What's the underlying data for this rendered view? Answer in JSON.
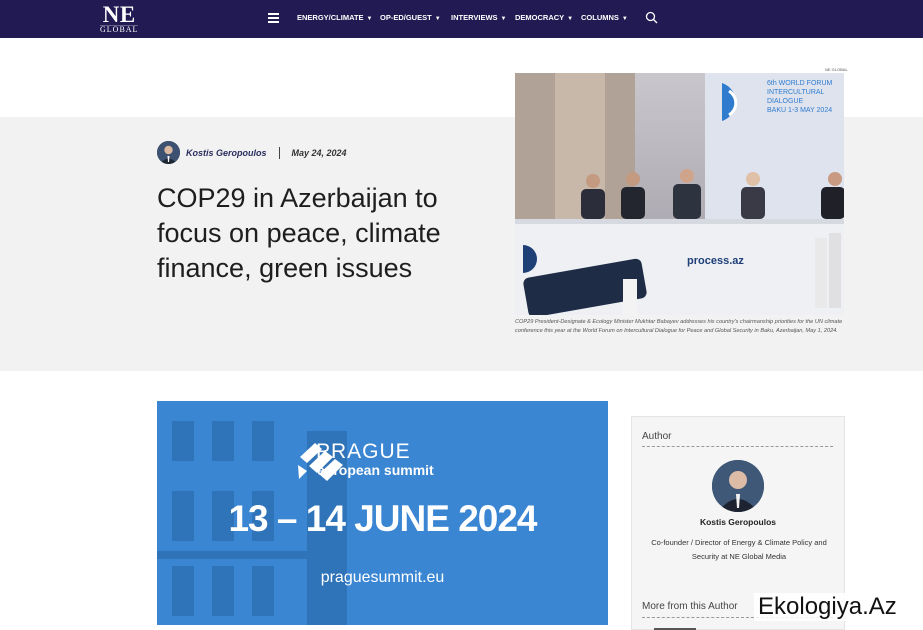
{
  "nav": {
    "logo_top": "NE",
    "logo_bottom": "GLOBAL",
    "menu": [
      {
        "label": "ENERGY/CLIMATE"
      },
      {
        "label": "OP-ED/GUEST"
      },
      {
        "label": "INTERVIEWS"
      },
      {
        "label": "DEMOCRACY"
      },
      {
        "label": "COLUMNS"
      }
    ]
  },
  "article": {
    "author": "Kostis Geropoulos",
    "date": "May 24, 2024",
    "title": "COP29 in Azerbaijan to focus on peace, climate finance, green issues",
    "photo_credit": "NE GLOBAL",
    "photo_sign": {
      "line1": "6th WORLD FORUM",
      "line2": "INTERCULTURAL",
      "line3": "DIALOGUE",
      "line4": "BAKU 1-3 MAY 2024",
      "desk_text": "process.az"
    },
    "caption": "COP29 President-Designate & Ecology Minister Mukhtar Babayev addresses his country's chairmanship priorities for the UN climate conference this year at the World Forum on Intercultural Dialogue for Peace and Global Security in Baku, Azerbaijan, May 1, 2024."
  },
  "banner": {
    "title": "PRAGUE",
    "subtitle": "european summit",
    "dates": "13 – 14 JUNE 2024",
    "url": "praguesummit.eu"
  },
  "sidebar": {
    "heading": "Author",
    "name": "Kostis Geropoulos",
    "bio": "Co-founder / Director of Energy & Climate Policy and Security at NE Global Media",
    "more_heading": "More from this Author"
  },
  "watermark": "Ekologiya.Az",
  "colors": {
    "nav_bg": "#221a52",
    "hero_band": "#f2f2f2",
    "banner_blue": "#2f7ccf",
    "author_link": "#2a2e5e"
  },
  "icons": {
    "menu": "hamburger-icon",
    "search": "search-icon",
    "dropdown": "chevron-down-icon"
  }
}
